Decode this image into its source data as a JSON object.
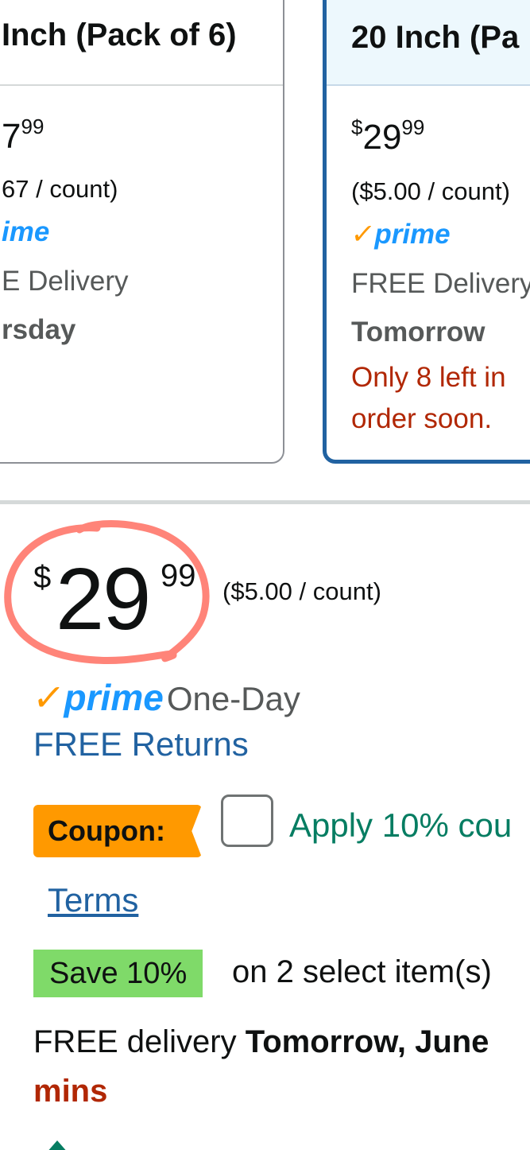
{
  "variants": [
    {
      "title": "Inch (Pack of 6)",
      "price_currency": "",
      "price_whole": "",
      "price_fraction": "99",
      "price_partial_whole": "7",
      "unit_price": "67 / count)",
      "prime": "ime",
      "delivery": "E Delivery",
      "delivery_day": "rsday",
      "selected": false
    },
    {
      "title": "20 Inch (Pa",
      "price_currency": "$",
      "price_whole": "29",
      "price_fraction": "99",
      "unit_price": "($5.00 / count)",
      "prime": "prime",
      "delivery": "FREE Delivery",
      "delivery_day": "Tomorrow",
      "stock_line1": "Only 8 left in",
      "stock_line2": "order soon.",
      "selected": true
    }
  ],
  "buybox": {
    "price_currency": "$",
    "price_whole": "29",
    "price_fraction": "99",
    "unit_price": "($5.00 / count)",
    "prime_label": "prime",
    "prime_speed": "One-Day",
    "free_returns": "FREE Returns",
    "coupon_label": "Coupon:",
    "coupon_text": "Apply 10% cou",
    "terms": "Terms",
    "save_badge": "Save 10%",
    "save_text": "on 2 select item(s)",
    "delivery_prefix": "FREE delivery",
    "delivery_date": "Tomorrow, June",
    "delivery_cutoff": "mins"
  },
  "colors": {
    "prime_blue": "#1a98ff",
    "prime_check": "#ff9900",
    "link_blue": "#2162a1",
    "stock_red": "#b12704",
    "coupon_orange": "#ff9900",
    "coupon_green": "#067d62",
    "save_green": "#7fda69",
    "annotation_circle": "#ff6f61"
  }
}
